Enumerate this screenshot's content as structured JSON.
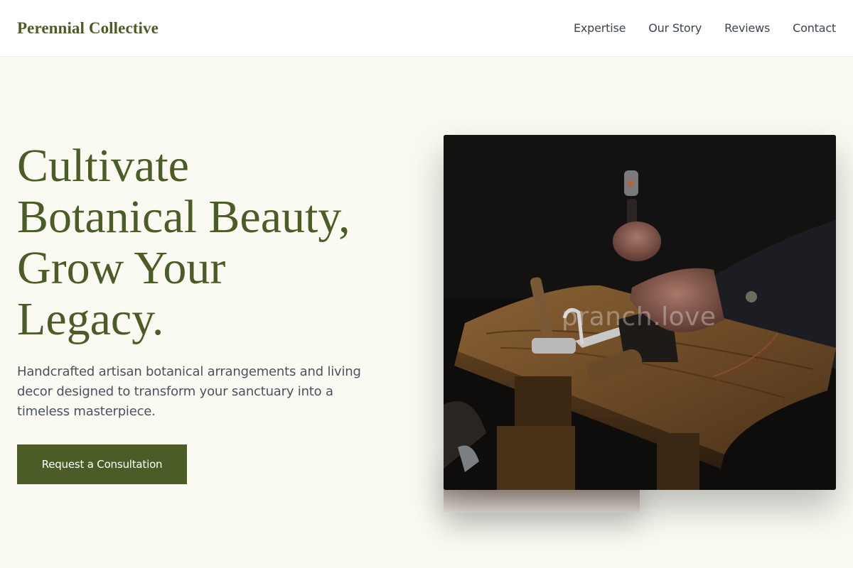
{
  "header": {
    "brand": "Perennial Collective",
    "nav": [
      "Expertise",
      "Our Story",
      "Reviews",
      "Contact"
    ]
  },
  "hero": {
    "title_lines": [
      "Cultivate",
      "Botanical Beauty,",
      "Grow Your",
      "Legacy."
    ],
    "subtitle": "Handcrafted artisan botanical arrangements and living decor designed to transform your sanctuary into a timeless masterpiece.",
    "cta_label": "Request a Consultation"
  },
  "image": {
    "watermark": "pranch.love"
  },
  "colors": {
    "brand": "#4b5c27",
    "background": "#fafaf3",
    "text_muted": "#4a5260"
  }
}
